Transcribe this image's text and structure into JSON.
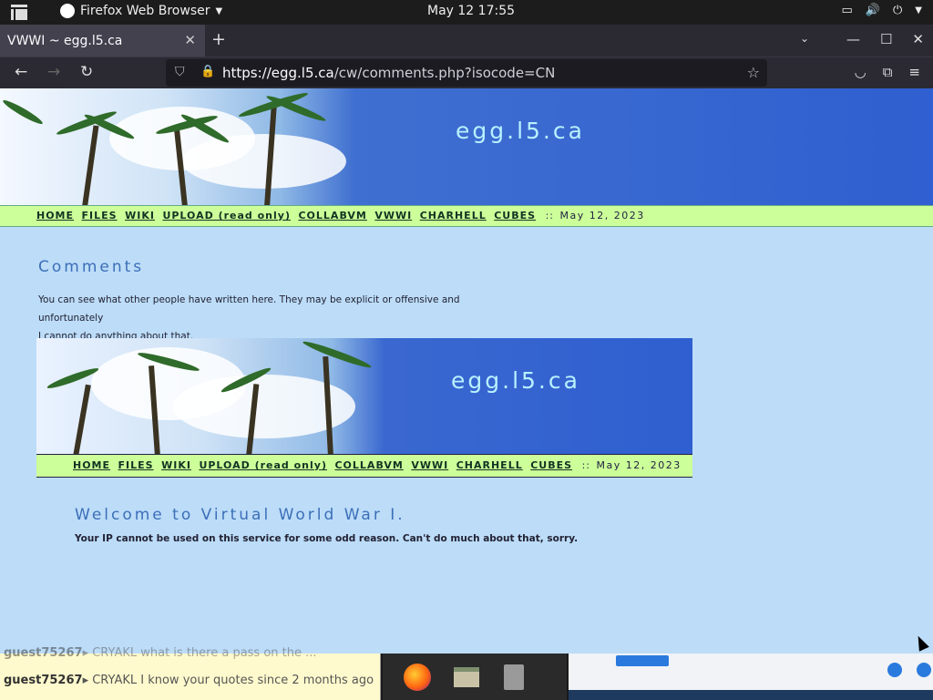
{
  "gnome": {
    "app_name": "Firefox Web Browser",
    "clock": "May 12  17:55"
  },
  "browser": {
    "tab_title": "VWWI ~ egg.l5.ca",
    "url_domain": "https://egg.l5.ca",
    "url_path": "/cw/comments.php?isocode=CN"
  },
  "site": {
    "title": "egg.l5.ca",
    "menu": [
      "HOME",
      "FILES",
      "WIKI",
      "UPLOAD (read only)",
      "COLLABVM",
      "VWWI",
      "CHARHELL",
      "CUBES"
    ],
    "separator": "::",
    "date": "May 12, 2023"
  },
  "comments": {
    "heading": "Comments",
    "line1": "You can see what other people have written here. They may be explicit or offensive and unfortunately",
    "line2": "I cannot do anything about that."
  },
  "frame": {
    "title": "egg.l5.ca",
    "welcome": "Welcome to Virtual World War I.",
    "ip_message": "Your IP cannot be used on this service for some odd reason. Can't do much about that, sorry."
  },
  "chat": {
    "line1_user": "guest75267",
    "line1_text": "CRYAKL what is there a pass on the ...",
    "line2_user": "guest75267",
    "line2_text": "CRYAKL I know your quotes since 2 months ago"
  },
  "colors": {
    "page_bg": "#bcdcf8",
    "menu_bg": "#ccff99",
    "heading": "#3c6fb8",
    "banner_blue": "#2f5fd0"
  }
}
